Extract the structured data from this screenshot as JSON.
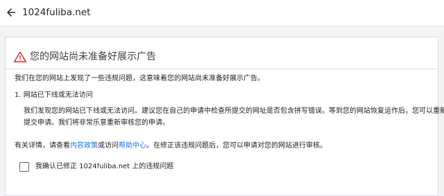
{
  "header": {
    "back_icon": "arrow-left-icon",
    "site": "1024fuliba.net"
  },
  "notice": {
    "warning_icon": "warning-triangle-icon",
    "warning_color": "#d93025",
    "title": "您的网站尚未准备好展示广告",
    "intro": "我们在您的网站上发现了一些违规问题，这意味着您的网站尚未准备好展示广告。",
    "issue": {
      "title": "1. 网站已下线或无法访问",
      "description_line1": "我们发现您的网站已下线或无法访问。建议您在自己的申请中检查所提交的网址是否包含拼写错误。等到您的网站恢复运作后，您可以重新",
      "description_line2": "提交申请。我们将非常乐意重新审核您的申请。"
    },
    "more_info": {
      "prefix": "有关详情，请查看",
      "policy_link": "内容政策",
      "middle": "或访问",
      "help_link": "帮助中心",
      "suffix": "。在修正该违规问题后，您可以申请对您的网站进行审核。"
    },
    "confirm": {
      "checked": false,
      "label": "我确认已修正 1024fuliba.net 上的违规问题"
    },
    "link_color": "#1a73e8"
  }
}
